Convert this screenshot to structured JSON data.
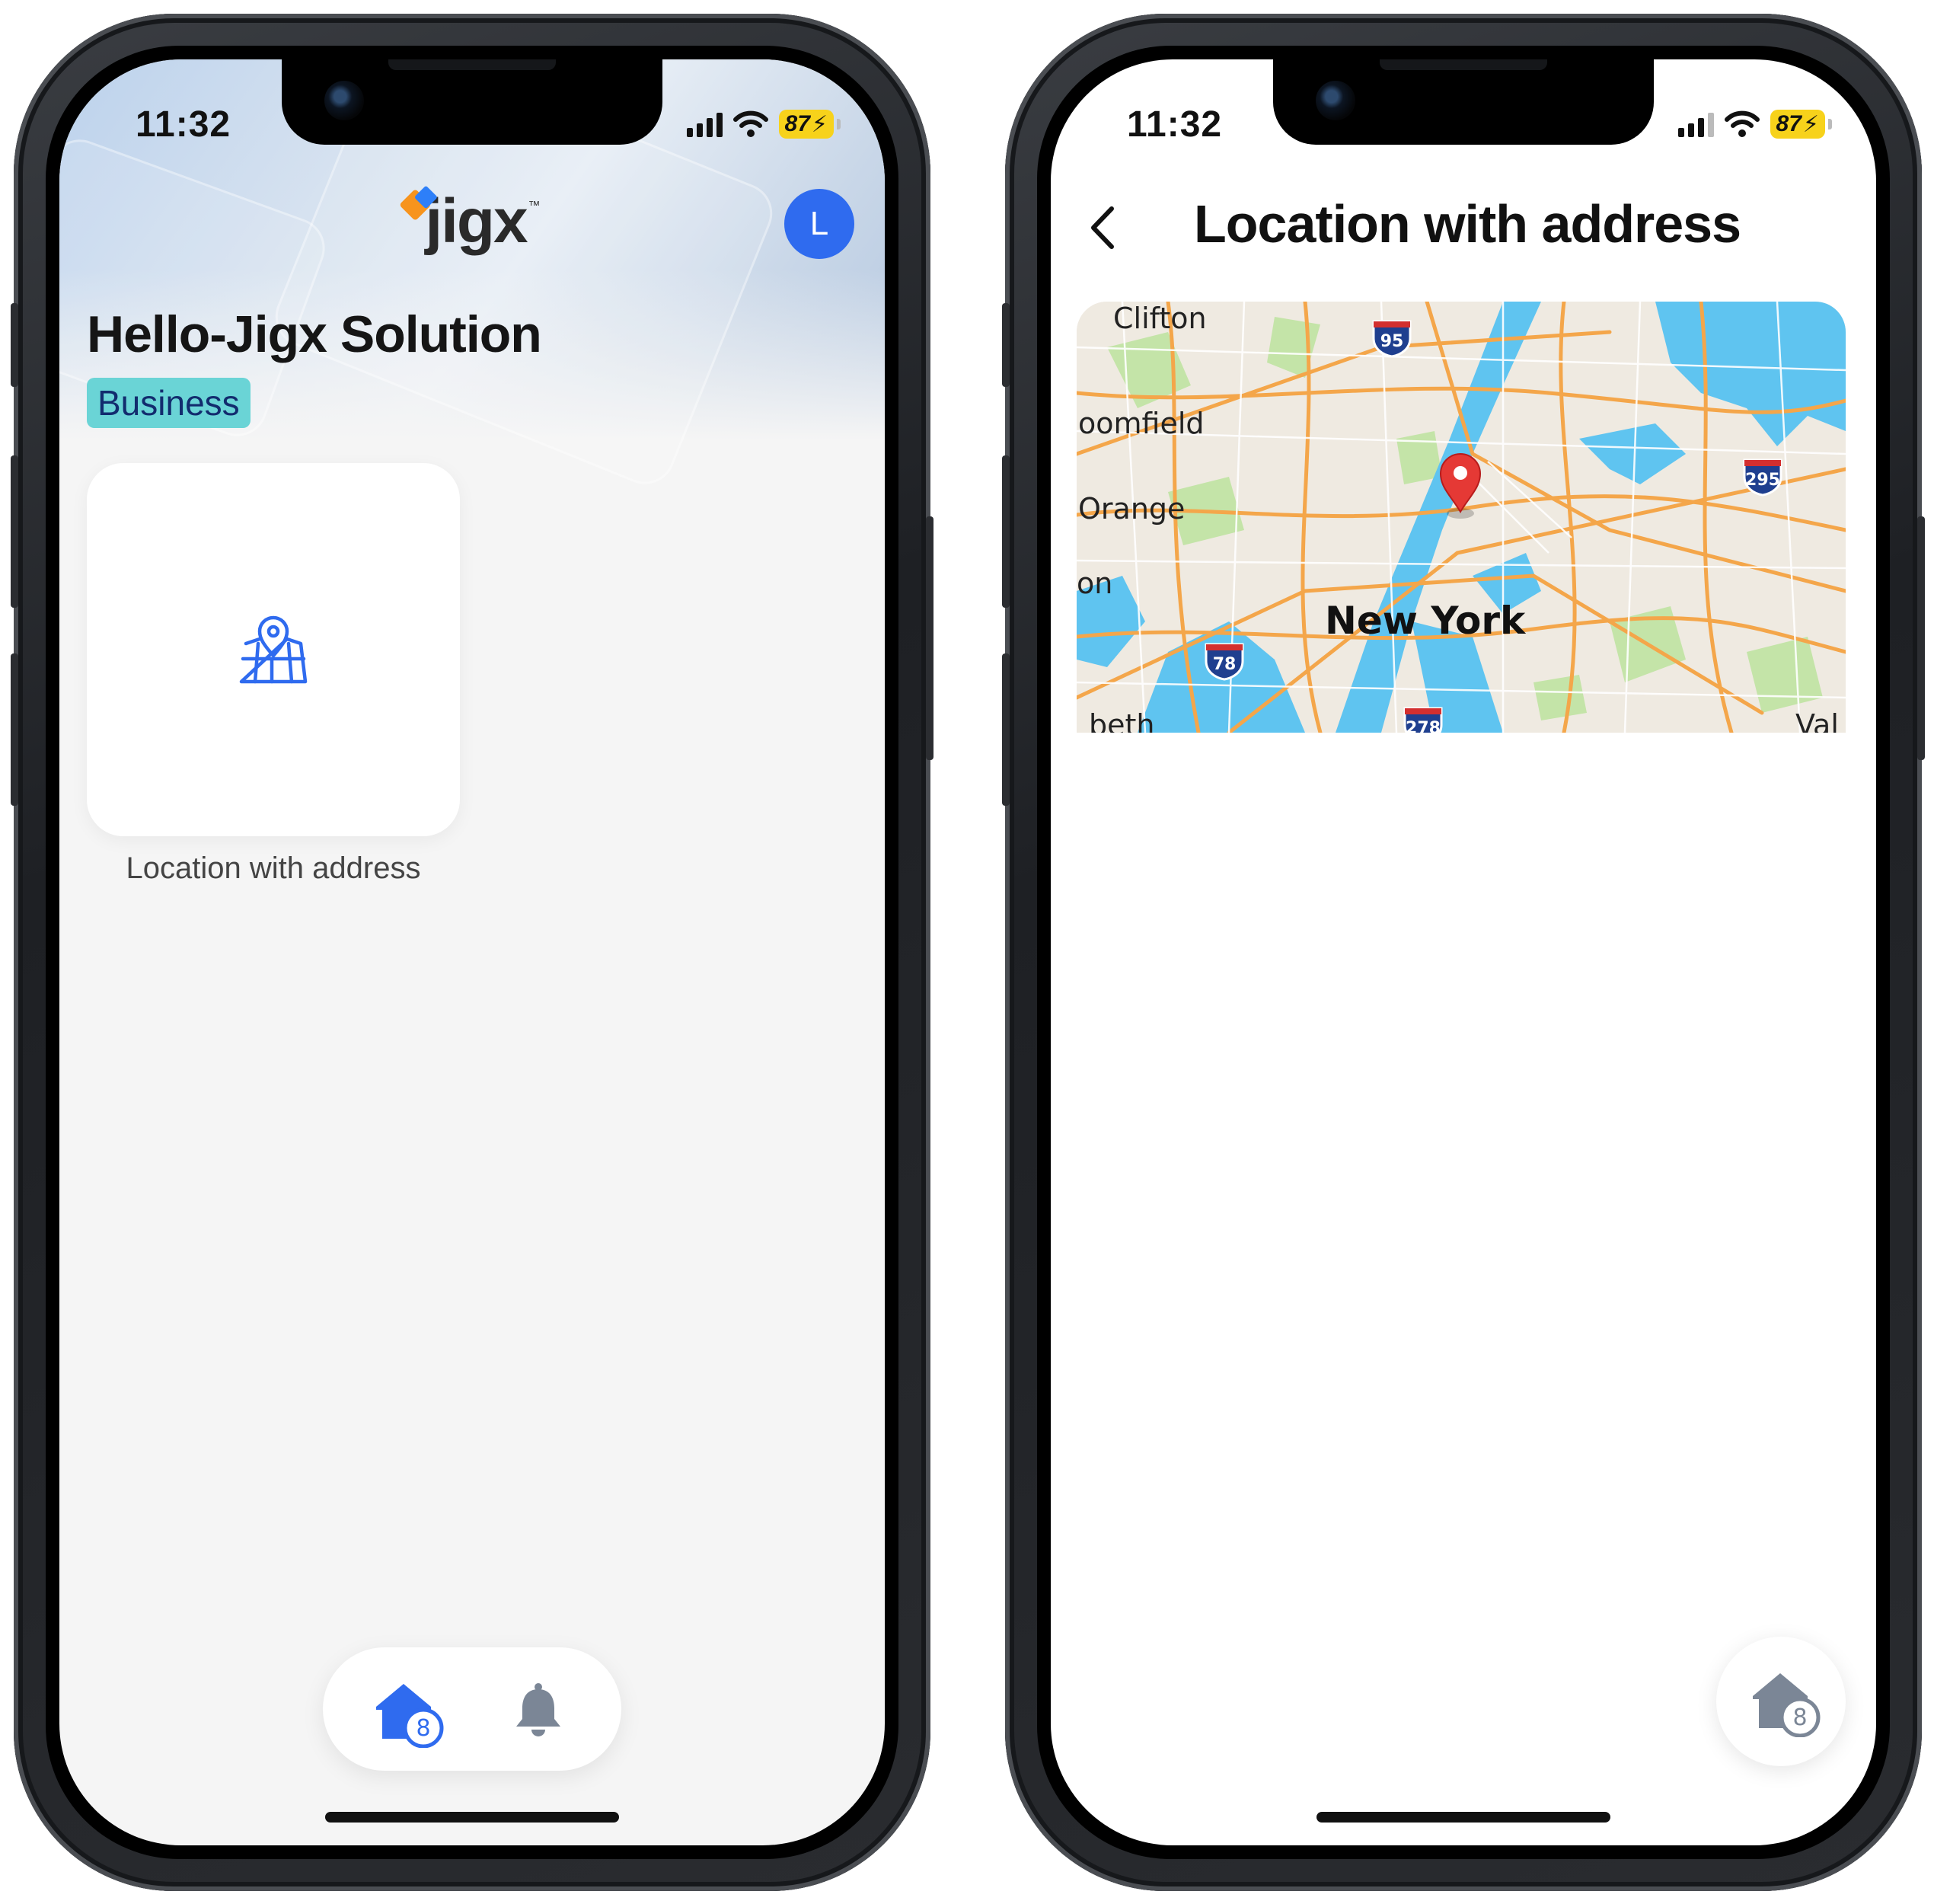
{
  "status_bar": {
    "time": "11:32",
    "battery": "87",
    "battery_color": "#f7d21b"
  },
  "home_screen": {
    "logo_text": "jigx",
    "logo_tm": "™",
    "avatar_initial": "L",
    "solution_title": "Hello-Jigx Solution",
    "badge": "Business",
    "tiles": [
      {
        "label": "Location with address",
        "icon": "map-pin-icon"
      }
    ],
    "tabbar": {
      "home_badge": "8",
      "home_icon": "home-icon",
      "notifications_icon": "bell-icon"
    }
  },
  "detail_screen": {
    "title": "Location with address",
    "back_icon": "chevron-left-icon",
    "map": {
      "labels": [
        "Clifton",
        "oomfield",
        "Orange",
        "on",
        "New York",
        "beth",
        "Val"
      ],
      "highway_shields": [
        "95",
        "295",
        "78",
        "278"
      ],
      "marker_icon": "map-marker-icon"
    },
    "fab_badge": "8"
  },
  "colors": {
    "accent": "#2f6bef",
    "badge_bg": "#6ad4d6",
    "marker": "#e53935",
    "map_road": "#f4a64a",
    "map_water": "#5bc2f0",
    "map_park": "#bfe3a3"
  }
}
